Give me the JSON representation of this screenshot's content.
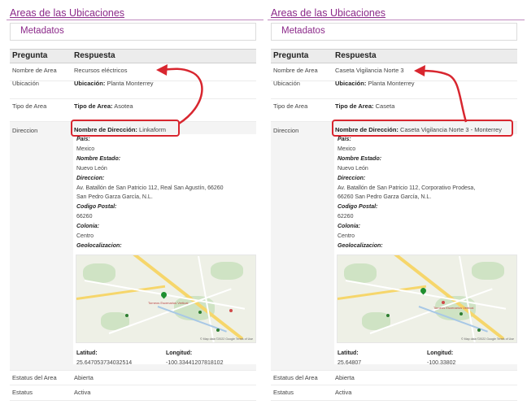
{
  "panels": [
    {
      "section_link": "Areas de las Ubicaciones",
      "metadata_title": "Metadatos",
      "headers": {
        "question": "Pregunta",
        "answer": "Respuesta"
      },
      "area_name": {
        "label": "Nombre de Area",
        "value": "Recursos eléctricos"
      },
      "location": {
        "label": "Ubicación",
        "key": "Ubicación:",
        "value": "Planta Monterrey"
      },
      "area_type": {
        "label": "Tipo de Area",
        "key": "Tipo de Area:",
        "value": "Asotea"
      },
      "direction": {
        "label": "Direccion",
        "name_key": "Nombre de Dirección:",
        "name_value": "Linkaform",
        "country_key": "País:",
        "country": "Mexico",
        "state_key": "Nombre Estado:",
        "state": "Nuevo León",
        "address_key": "Direccion:",
        "address_line1": "Av. Batallón de San Patricio 112, Real San Agustín, 66260",
        "address_line2": "San Pedro Garza García, N.L.",
        "zip_key": "Codigo Postal:",
        "zip": "66260",
        "colony_key": "Colonia:",
        "colony": "Centro",
        "geo_key": "Geolocalizacion:",
        "lat_key": "Latitud:",
        "lat": "25.647053734032514",
        "lng_key": "Longitud:",
        "lng": "-100.33441207818102",
        "map_place": "Torneos Escenarios Vertical",
        "map_copyright": "© Map data ©2022 Google  Terms of Use"
      },
      "status": {
        "label": "Estatus del Area",
        "value": "Abierta"
      },
      "state": {
        "label": "Estatus",
        "value": "Activa"
      }
    },
    {
      "section_link": "Areas de las Ubicaciones",
      "metadata_title": "Metadatos",
      "headers": {
        "question": "Pregunta",
        "answer": "Respuesta"
      },
      "area_name": {
        "label": "Nombre de Area",
        "value": "Caseta Vigilancia Norte 3"
      },
      "location": {
        "label": "Ubicación",
        "key": "Ubicación:",
        "value": "Planta Monterrey"
      },
      "area_type": {
        "label": "Tipo de Area",
        "key": "Tipo de Area:",
        "value": "Caseta"
      },
      "direction": {
        "label": "Direccion",
        "name_key": "Nombre de Dirección:",
        "name_value": "Caseta Vigilancia Norte 3 - Monterrey",
        "country_key": "País:",
        "country": "Mexico",
        "state_key": "Nombre Estado:",
        "state": "Nuevo León",
        "address_key": "Direccion:",
        "address_line1": "Av. Batallón de San Patricio 112, Corporativo Prodesa,",
        "address_line2": "66260 San Pedro Garza García, N.L.",
        "zip_key": "Codigo Postal:",
        "zip": "62260",
        "colony_key": "Colonia:",
        "colony": "Centro",
        "geo_key": "Geolocalizacion:",
        "lat_key": "Latitud:",
        "lat": "25.64807",
        "lng_key": "Longitud:",
        "lng": "-100.33802",
        "map_place": "Torneos Escenarios Vertical",
        "map_copyright": "© Map data ©2022 Google  Terms of Use"
      },
      "status": {
        "label": "Estatus del Area",
        "value": "Abierta"
      },
      "state": {
        "label": "Estatus",
        "value": "Activa"
      }
    }
  ],
  "colors": {
    "accent": "#8c2a8a",
    "highlight": "#d8262f",
    "map_pin": "#1f8f2f"
  }
}
